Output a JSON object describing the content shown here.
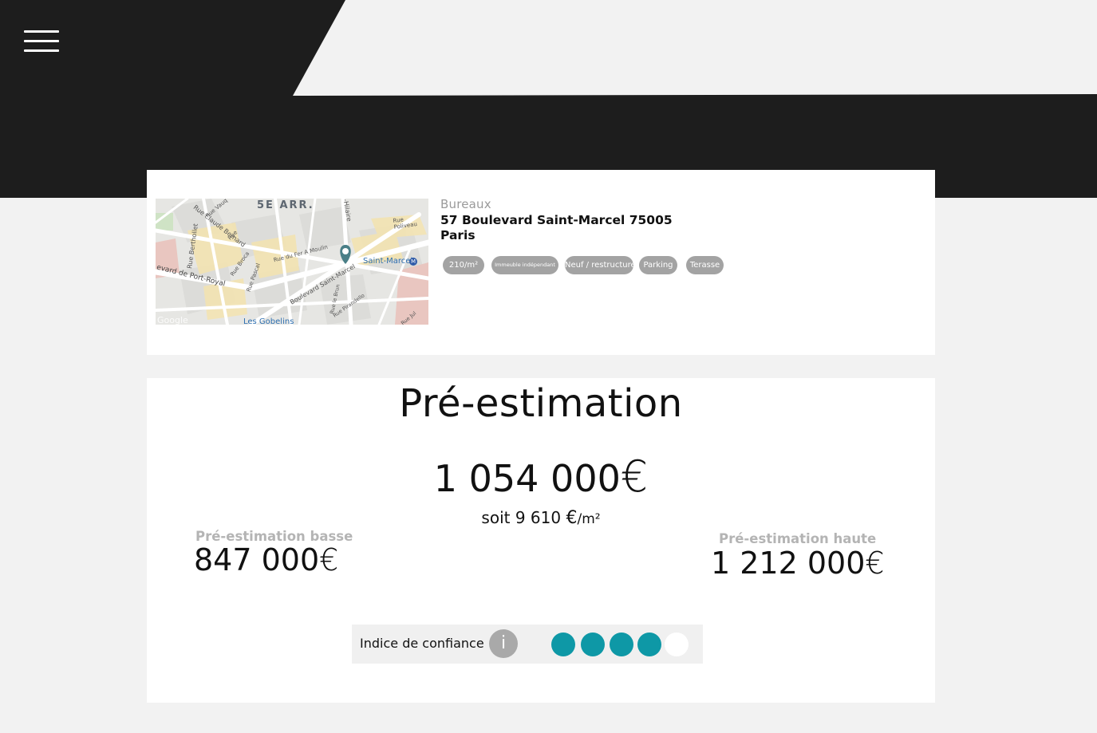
{
  "header": {
    "menu_icon": "hamburger-menu-icon"
  },
  "property": {
    "type": "Bureaux",
    "address_line1": "57 Boulevard Saint-Marcel 75005",
    "address_line2": "Paris",
    "tags": [
      "210/m²",
      "Immeuble indépendant",
      "Neuf / restructuré",
      "Parking",
      "Terasse"
    ],
    "map": {
      "district": "5E ARR.",
      "streets": [
        "Rue Claude Bernard",
        "Rue du Fer A Moulin",
        "Boulevard Saint-Marcel",
        "Rue Poliveau",
        "Rue Berthollet",
        "evard de Port-Royal",
        "Rue Broca",
        "Rue Pascal",
        "Rue le Brun",
        "Rue Pirandello",
        "Rue Vauq",
        "Rue",
        "-Hilaire",
        "Rue Jul"
      ],
      "metro_stations": [
        "Saint-Marcel",
        "Les Gobelins"
      ],
      "attribution": "Google",
      "marker_icon": "map-pin-icon"
    }
  },
  "estimate": {
    "title": "Pré-estimation",
    "main_value": "1 054 000",
    "currency": "€",
    "per_sqm_prefix": "soit",
    "per_sqm_value": "9 610",
    "per_sqm_unit": "/m²",
    "low_label": "Pré-estimation basse",
    "low_value": "847 000",
    "high_label": "Pré-estimation haute",
    "high_value": "1 212 000"
  },
  "confidence": {
    "label": "Indice de confiance",
    "info_icon": "i",
    "level": 4,
    "max": 5,
    "on_color": "#0e98a6",
    "off_color": "#ffffff"
  }
}
